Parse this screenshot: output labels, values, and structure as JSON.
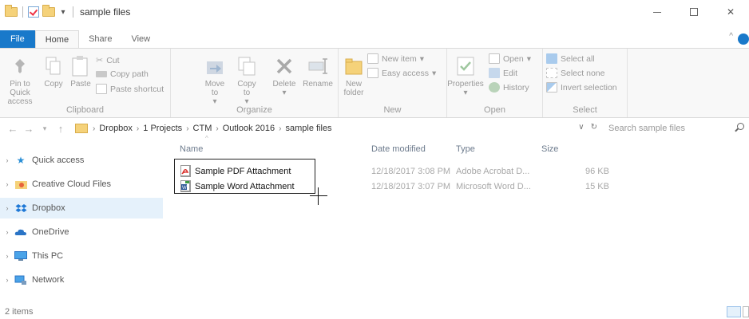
{
  "window": {
    "title": "sample files"
  },
  "ribbon_tabs": [
    "File",
    "Home",
    "Share",
    "View"
  ],
  "ribbon": {
    "clipboard": {
      "label": "Clipboard",
      "pin": "Pin to Quick access",
      "copy": "Copy",
      "paste": "Paste",
      "cut": "Cut",
      "copy_path": "Copy path",
      "paste_shortcut": "Paste shortcut"
    },
    "organize": {
      "label": "Organize",
      "move_to": "Move to",
      "copy_to": "Copy to",
      "delete": "Delete",
      "rename": "Rename"
    },
    "new": {
      "label": "New",
      "new_folder": "New folder",
      "new_item": "New item",
      "easy_access": "Easy access"
    },
    "open": {
      "label": "Open",
      "properties": "Properties",
      "open": "Open",
      "edit": "Edit",
      "history": "History"
    },
    "select": {
      "label": "Select",
      "select_all": "Select all",
      "select_none": "Select none",
      "invert_selection": "Invert selection"
    }
  },
  "address": {
    "crumbs": [
      "Dropbox",
      "1 Projects",
      "CTM",
      "Outlook 2016",
      "sample files"
    ],
    "search_placeholder": "Search sample files"
  },
  "nav": {
    "items": [
      {
        "label": "Quick access",
        "icon": "star-icon",
        "selected": false
      },
      {
        "label": "Creative Cloud Files",
        "icon": "cc-folder-icon",
        "selected": false
      },
      {
        "label": "Dropbox",
        "icon": "dropbox-icon",
        "selected": true
      },
      {
        "label": "OneDrive",
        "icon": "cloud-icon",
        "selected": false
      },
      {
        "label": "This PC",
        "icon": "monitor-icon",
        "selected": false
      },
      {
        "label": "Network",
        "icon": "network-icon",
        "selected": false
      }
    ]
  },
  "columns": {
    "name": "Name",
    "date_modified": "Date modified",
    "type": "Type",
    "size": "Size"
  },
  "files": [
    {
      "name": "Sample PDF Attachment",
      "date": "12/18/2017 3:08 PM",
      "type": "Adobe Acrobat D...",
      "size": "96 KB",
      "icon": "pdf-icon"
    },
    {
      "name": "Sample Word Attachment",
      "date": "12/18/2017 3:07 PM",
      "type": "Microsoft Word D...",
      "size": "15 KB",
      "icon": "word-icon"
    }
  ],
  "status": {
    "item_count": "2 items"
  },
  "colors": {
    "accent": "#1979ca",
    "selected_nav": "#e5f1fb",
    "disabled_text": "#9a9a9a"
  }
}
